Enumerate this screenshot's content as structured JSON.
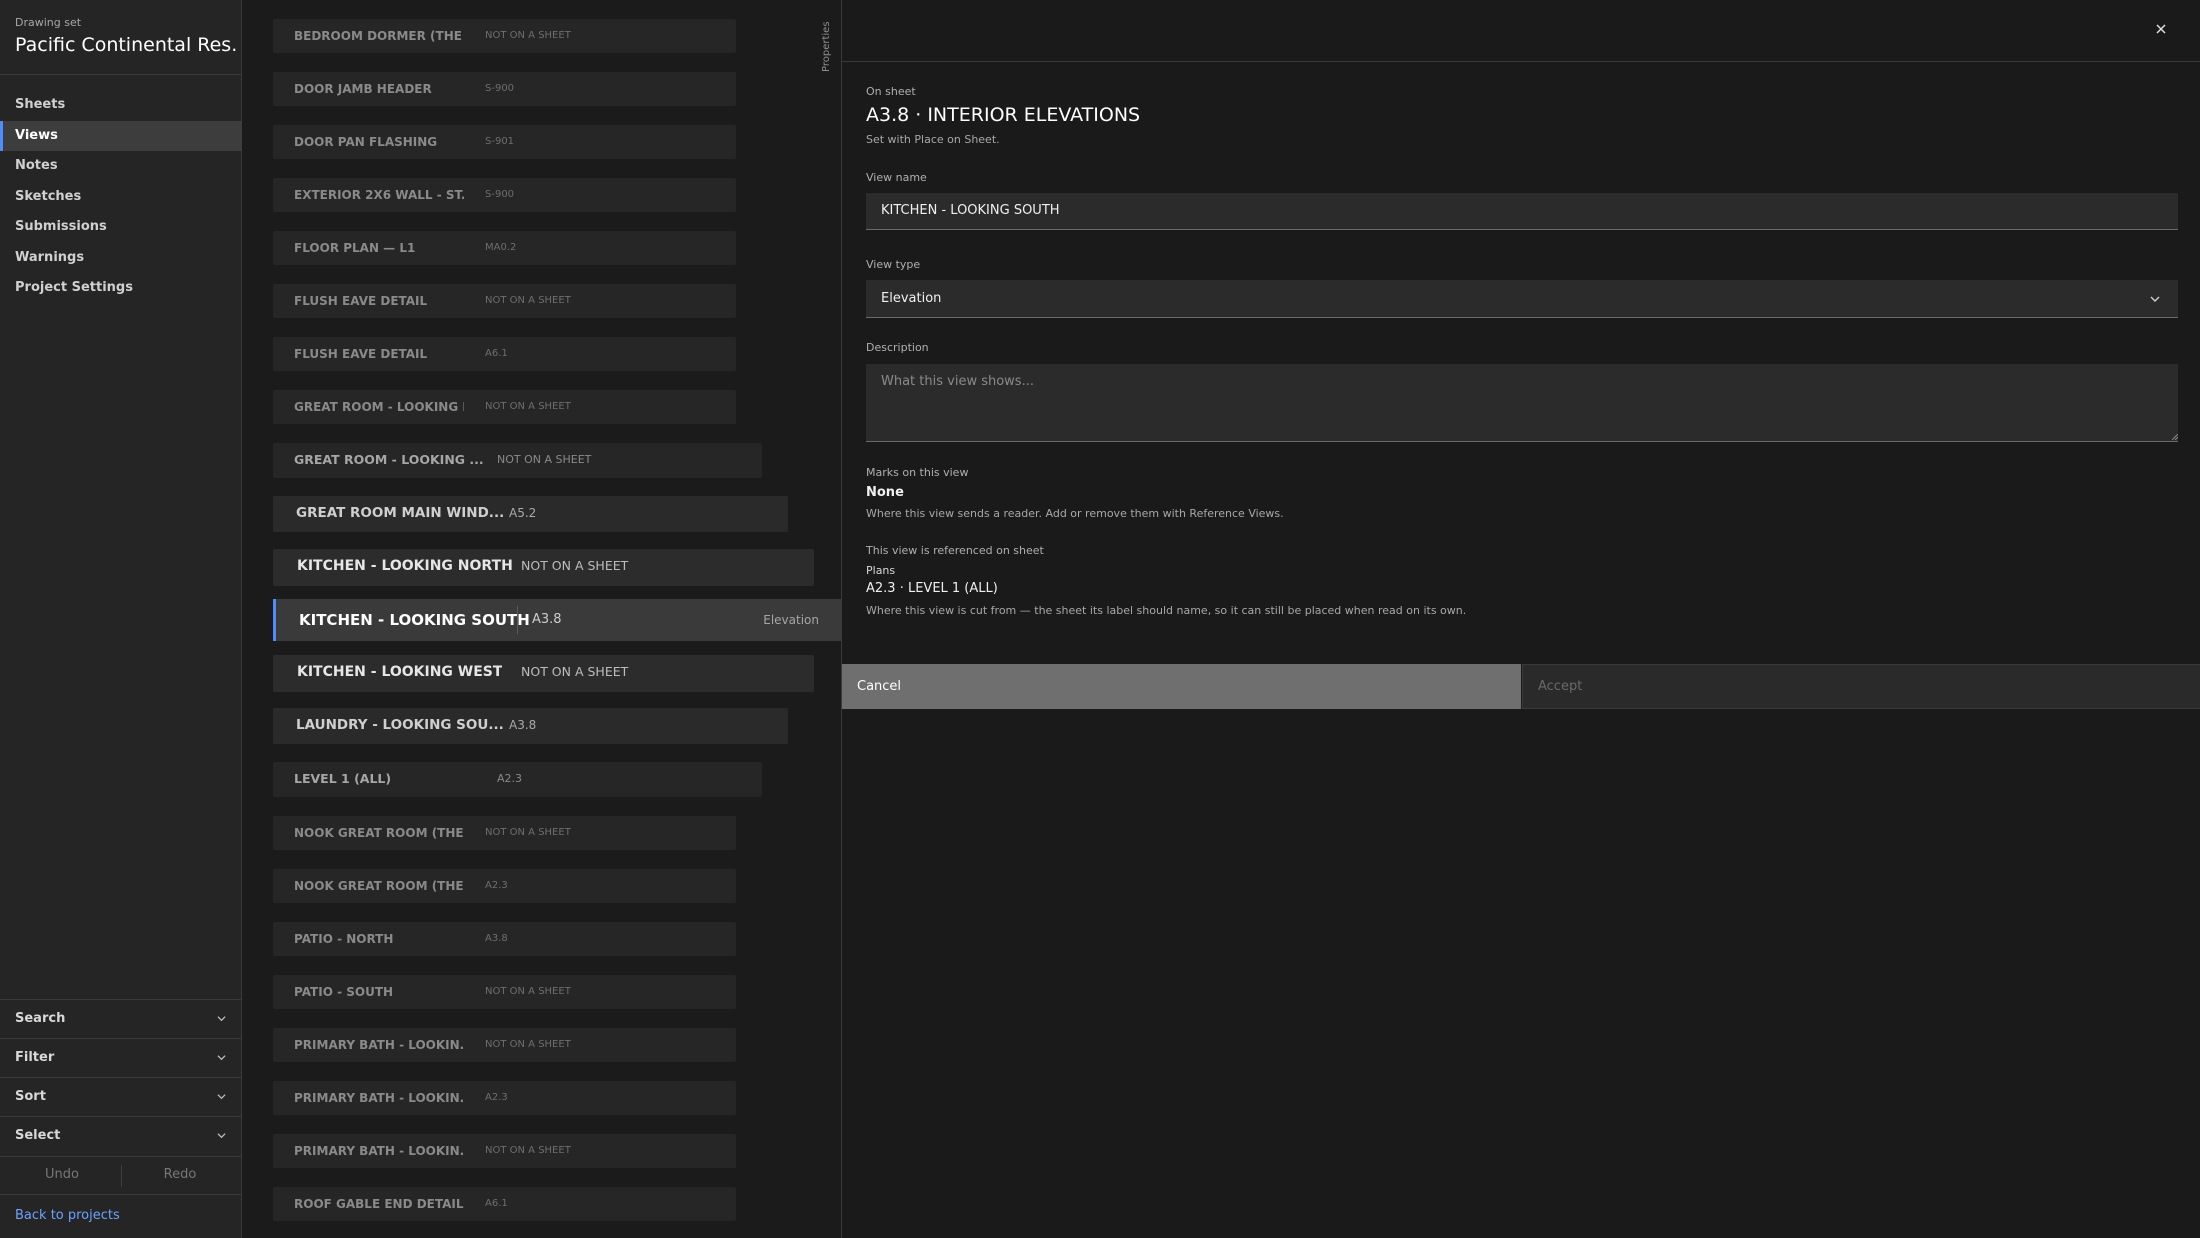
{
  "sidebar": {
    "set_label": "Drawing set",
    "set_title": "Pacific Continental Res...",
    "nav": [
      {
        "label": "Sheets",
        "active": false
      },
      {
        "label": "Views",
        "active": true
      },
      {
        "label": "Notes",
        "active": false
      },
      {
        "label": "Sketches",
        "active": false
      },
      {
        "label": "Submissions",
        "active": false
      },
      {
        "label": "Warnings",
        "active": false
      },
      {
        "label": "Project Settings",
        "active": false
      }
    ],
    "accordions": [
      "Search",
      "Filter",
      "Sort",
      "Select"
    ],
    "undo_label": "Undo",
    "redo_label": "Redo",
    "back_label": "Back to projects"
  },
  "views": [
    {
      "name": "BEDROOM DORMER (THE ...",
      "sheet": "NOT ON A SHEET"
    },
    {
      "name": "DOOR JAMB HEADER",
      "sheet": "S-900"
    },
    {
      "name": "DOOR PAN FLASHING",
      "sheet": "S-901"
    },
    {
      "name": "EXTERIOR 2X6 WALL - ST...",
      "sheet": "S-900"
    },
    {
      "name": "FLOOR PLAN — L1",
      "sheet": "MA0.2"
    },
    {
      "name": "FLUSH EAVE DETAIL",
      "sheet": "NOT ON A SHEET"
    },
    {
      "name": "FLUSH EAVE DETAIL",
      "sheet": "A6.1"
    },
    {
      "name": "GREAT ROOM - LOOKING E...",
      "sheet": "NOT ON A SHEET"
    },
    {
      "name": "GREAT ROOM - LOOKING ...",
      "sheet": "NOT ON A SHEET"
    },
    {
      "name": "GREAT ROOM MAIN WIND...",
      "sheet": "A5.2"
    },
    {
      "name": "KITCHEN - LOOKING NORTH",
      "sheet": "NOT ON A SHEET"
    },
    {
      "name": "KITCHEN - LOOKING SOUTH",
      "sheet": "A3.8",
      "type": "Elevation",
      "selected": true
    },
    {
      "name": "KITCHEN - LOOKING WEST",
      "sheet": "NOT ON A SHEET"
    },
    {
      "name": "LAUNDRY - LOOKING SOU...",
      "sheet": "A3.8"
    },
    {
      "name": "LEVEL 1 (ALL)",
      "sheet": "A2.3"
    },
    {
      "name": "NOOK GREAT ROOM (THE ...",
      "sheet": "NOT ON A SHEET"
    },
    {
      "name": "NOOK GREAT ROOM (THE ...",
      "sheet": "A2.3"
    },
    {
      "name": "PATIO - NORTH",
      "sheet": "A3.8"
    },
    {
      "name": "PATIO - SOUTH",
      "sheet": "NOT ON A SHEET"
    },
    {
      "name": "PRIMARY BATH - LOOKIN...",
      "sheet": "NOT ON A SHEET"
    },
    {
      "name": "PRIMARY BATH - LOOKIN...",
      "sheet": "A2.3"
    },
    {
      "name": "PRIMARY BATH - LOOKIN...",
      "sheet": "NOT ON A SHEET"
    },
    {
      "name": "ROOF GABLE END DETAIL",
      "sheet": "A6.1"
    }
  ],
  "properties_tab": "Properties",
  "panel": {
    "close_symbol": "×",
    "on_sheet_label": "On sheet",
    "on_sheet_title": "A3.8 · INTERIOR ELEVATIONS",
    "on_sheet_hint": "Set with Place on Sheet.",
    "view_name_label": "View name",
    "view_name_value": "KITCHEN - LOOKING SOUTH",
    "view_type_label": "View type",
    "view_type_value": "Elevation",
    "description_label": "Description",
    "description_placeholder": "What this view shows...",
    "marks_label": "Marks on this view",
    "marks_value": "None",
    "marks_hint": "Where this view sends a reader. Add or remove them with Reference Views.",
    "ref_label": "This view is referenced on sheet",
    "ref_group": "Plans",
    "ref_value": "A2.3 · LEVEL 1 (ALL)",
    "ref_hint": "Where this view is cut from — the sheet its label should name, so it can still be placed when read on its own.",
    "cancel_label": "Cancel",
    "accept_label": "Accept"
  },
  "colors": {
    "accent": "#4d8dff",
    "link": "#6aa3ff",
    "panel_bg": "#1a1a1a",
    "sidebar_bg": "#252525"
  }
}
